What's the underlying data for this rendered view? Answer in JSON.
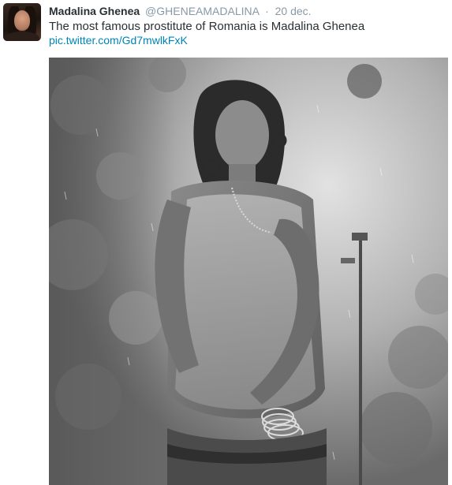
{
  "tweet": {
    "author_name": "Madalina Ghenea",
    "handle": "@GHENEAMADALINA",
    "separator": "·",
    "timestamp": "20 dec.",
    "text": "The most famous prostitute of Romania is Madalina Ghenea",
    "link": "pic.twitter.com/Gd7mwlkFxK"
  },
  "colors": {
    "name": "#292f33",
    "muted": "#8899a6",
    "link": "#0084b4"
  },
  "icons": {
    "avatar": "profile-photo"
  }
}
